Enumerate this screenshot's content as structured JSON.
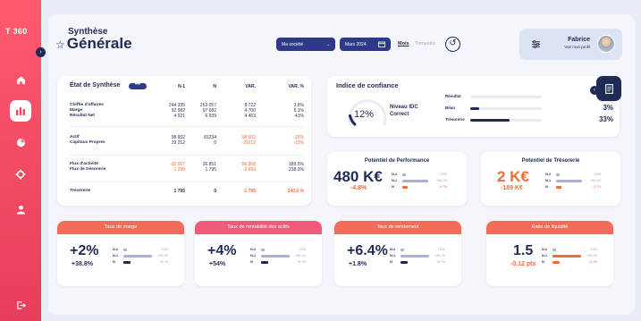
{
  "app": {
    "logo": "T 360"
  },
  "sidebar": {
    "items": [
      "home-icon",
      "chart-icon",
      "pie-icon",
      "gear-icon",
      "user-icon",
      "logout-icon"
    ]
  },
  "header": {
    "title_small": "Synthèse",
    "title_big": "Générale",
    "star": "☆",
    "company": "Ma société",
    "period": "Mars 2024",
    "mode_month": "Mois",
    "mode_quarter": "Trimestre"
  },
  "profile": {
    "name": "Fabrice",
    "link": "Voir mon profil"
  },
  "synthese": {
    "title": "État de Synthèse",
    "headers": [
      "N-1",
      "N",
      "VAR.",
      "VAR. %"
    ],
    "rows": [
      {
        "labels": "Chiffre d'affaires\nMarge\nRésultat Net",
        "n1": "244 335\n92 982\n4 921",
        "n": "253 057\n97 682\n6 939",
        "var": "8 722\n4 700\n4 453",
        "pct": "3.6%\n5.1%\n41%",
        "bold_last": true,
        "neg": false
      },
      {
        "labels": "Actif\nCapitaux Propres",
        "n1": "98 602\n29 212",
        "n": "81234\n0",
        "var": "-98 602\n-29212",
        "pct": "-25%\n-13%",
        "bold_last": true,
        "neg": true
      },
      {
        "labels": "Flux d'activité\nFlux de trésorerie",
        "n1": "-30 007\n1 298",
        "n": "26 851\n1 795",
        "var": "-56 858\n-3 693",
        "pct": "189.5%\n238.3%",
        "bold_last": true,
        "neg": true
      },
      {
        "labels": "Trésorerie",
        "n1": "1 795",
        "n": "0",
        "var": "-1 795",
        "pct": "240.0 %",
        "bold_last": false,
        "neg": true
      }
    ]
  },
  "idc": {
    "title": "Indice de confiance",
    "value": "12%",
    "label1": "Niveau IDC",
    "label2": "Correct",
    "gauge_fraction": 0.12,
    "bars": [
      {
        "label": "Résultat",
        "pct": "0%",
        "fraction": 0.0,
        "color": "#f46b3a"
      },
      {
        "label": "Bilan",
        "pct": "3%",
        "fraction": 0.12,
        "color": "#1f2a55"
      },
      {
        "label": "Trésorerie",
        "pct": "33%",
        "fraction": 0.55,
        "color": "#1f2a55"
      }
    ]
  },
  "performance": {
    "title": "Potentiel de Performance",
    "value": "480 K€",
    "delta": "-4.8%",
    "color": "#1f2a55",
    "rows": [
      {
        "label": "N-2",
        "pct": "+13%",
        "fraction": 0.1,
        "color": "#aab3d6"
      },
      {
        "label": "N-1",
        "pct": "+60.2%",
        "fraction": 0.7,
        "color": "#aab3d6"
      },
      {
        "label": "N",
        "pct": "-6.7%",
        "fraction": 0.15,
        "color": "#f46b3a"
      }
    ]
  },
  "tresorerie": {
    "title": "Potentiel de Trésorerie",
    "value": "2 K€",
    "delta": "-189 K€",
    "color": "#f46b3a",
    "rows": [
      {
        "label": "N-2",
        "pct": "+10%",
        "fraction": 0.1,
        "color": "#aab3d6"
      },
      {
        "label": "N-1",
        "pct": "+60.2%",
        "fraction": 0.7,
        "color": "#aab3d6"
      },
      {
        "label": "N",
        "pct": "-3.7%",
        "fraction": 0.15,
        "color": "#f46b3a"
      }
    ]
  },
  "kpis": [
    {
      "title": "Taux de marge",
      "value": "+2%",
      "delta": "+38.8%",
      "band": "#f46b5a",
      "valColor": "#1f2a55",
      "deltaColor": "#1f2a55",
      "rows": [
        {
          "label": "N-2",
          "pct": "+13%",
          "fraction": 0.1,
          "color": "#aab3d6"
        },
        {
          "label": "N-1",
          "pct": "+60.2%",
          "fraction": 0.75,
          "color": "#aab3d6"
        },
        {
          "label": "N",
          "pct": "+5.7%",
          "fraction": 0.2,
          "color": "#1f2a55"
        }
      ]
    },
    {
      "title": "Taux de rentabilité des actifs",
      "value": "+4%",
      "delta": "+54%",
      "band": "#f25a7a",
      "valColor": "#1f2a55",
      "deltaColor": "#1f2a55",
      "rows": [
        {
          "label": "N-2",
          "pct": "+13%",
          "fraction": 0.1,
          "color": "#aab3d6"
        },
        {
          "label": "N-1",
          "pct": "+60.2%",
          "fraction": 0.75,
          "color": "#aab3d6"
        },
        {
          "label": "N",
          "pct": "+5.7%",
          "fraction": 0.2,
          "color": "#1f2a55"
        }
      ]
    },
    {
      "title": "Taux de rendement",
      "value": "+6.4%",
      "delta": "+1.8%",
      "band": "#f46b5a",
      "valColor": "#1f2a55",
      "deltaColor": "#1f2a55",
      "rows": [
        {
          "label": "N-2",
          "pct": "+13%",
          "fraction": 0.1,
          "color": "#aab3d6"
        },
        {
          "label": "N-1",
          "pct": "+60.2%",
          "fraction": 0.75,
          "color": "#aab3d6"
        },
        {
          "label": "N",
          "pct": "+5.7%",
          "fraction": 0.2,
          "color": "#1f2a55"
        }
      ]
    },
    {
      "title": "Ratio de liquidité",
      "value": "1.5",
      "delta": "-0.12 pts",
      "band": "#f46b5a",
      "valColor": "#1f2a55",
      "deltaColor": "#f46b3a",
      "rows": [
        {
          "label": "N-2",
          "pct": "+13%",
          "fraction": 0.1,
          "color": "#aab3d6"
        },
        {
          "label": "N-1",
          "pct": "+60.2%",
          "fraction": 0.75,
          "color": "#f46b3a"
        },
        {
          "label": "N",
          "pct": "-6.1%",
          "fraction": 0.2,
          "color": "#f46b3a"
        }
      ]
    }
  ]
}
